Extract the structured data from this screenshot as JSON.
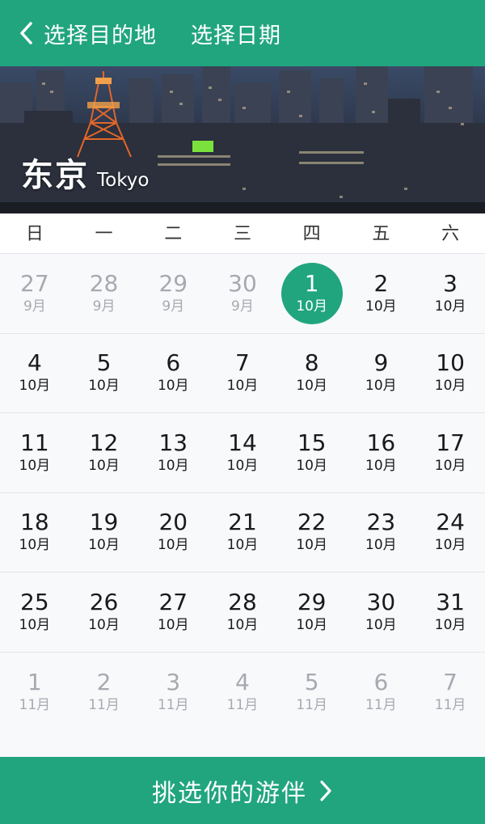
{
  "header": {
    "back_icon": "chevron-left-icon",
    "title_destination": "选择目的地",
    "title_date": "选择日期"
  },
  "hero": {
    "city_cn": "东京",
    "city_en": "Tokyo"
  },
  "weekdays": [
    "日",
    "一",
    "二",
    "三",
    "四",
    "五",
    "六"
  ],
  "calendar": {
    "weeks": [
      [
        {
          "day": "27",
          "month": "9月",
          "muted": true
        },
        {
          "day": "28",
          "month": "9月",
          "muted": true
        },
        {
          "day": "29",
          "month": "9月",
          "muted": true
        },
        {
          "day": "30",
          "month": "9月",
          "muted": true
        },
        {
          "day": "1",
          "month": "10月",
          "selected": true
        },
        {
          "day": "2",
          "month": "10月"
        },
        {
          "day": "3",
          "month": "10月"
        }
      ],
      [
        {
          "day": "4",
          "month": "10月"
        },
        {
          "day": "5",
          "month": "10月"
        },
        {
          "day": "6",
          "month": "10月"
        },
        {
          "day": "7",
          "month": "10月"
        },
        {
          "day": "8",
          "month": "10月"
        },
        {
          "day": "9",
          "month": "10月"
        },
        {
          "day": "10",
          "month": "10月"
        }
      ],
      [
        {
          "day": "11",
          "month": "10月"
        },
        {
          "day": "12",
          "month": "10月"
        },
        {
          "day": "13",
          "month": "10月"
        },
        {
          "day": "14",
          "month": "10月"
        },
        {
          "day": "15",
          "month": "10月"
        },
        {
          "day": "16",
          "month": "10月"
        },
        {
          "day": "17",
          "month": "10月"
        }
      ],
      [
        {
          "day": "18",
          "month": "10月"
        },
        {
          "day": "19",
          "month": "10月"
        },
        {
          "day": "20",
          "month": "10月"
        },
        {
          "day": "21",
          "month": "10月"
        },
        {
          "day": "22",
          "month": "10月"
        },
        {
          "day": "23",
          "month": "10月"
        },
        {
          "day": "24",
          "month": "10月"
        }
      ],
      [
        {
          "day": "25",
          "month": "10月"
        },
        {
          "day": "26",
          "month": "10月"
        },
        {
          "day": "27",
          "month": "10月"
        },
        {
          "day": "28",
          "month": "10月"
        },
        {
          "day": "29",
          "month": "10月"
        },
        {
          "day": "30",
          "month": "10月"
        },
        {
          "day": "31",
          "month": "10月"
        }
      ],
      [
        {
          "day": "1",
          "month": "11月",
          "muted": true
        },
        {
          "day": "2",
          "month": "11月",
          "muted": true
        },
        {
          "day": "3",
          "month": "11月",
          "muted": true
        },
        {
          "day": "4",
          "month": "11月",
          "muted": true
        },
        {
          "day": "5",
          "month": "11月",
          "muted": true
        },
        {
          "day": "6",
          "month": "11月",
          "muted": true
        },
        {
          "day": "7",
          "month": "11月",
          "muted": true
        }
      ]
    ]
  },
  "footer": {
    "button_label": "挑选你的游伴",
    "button_icon": "chevron-right-icon"
  },
  "colors": {
    "accent": "#21a57f",
    "muted_text": "#a6aab0",
    "text": "#1a1a1a"
  }
}
